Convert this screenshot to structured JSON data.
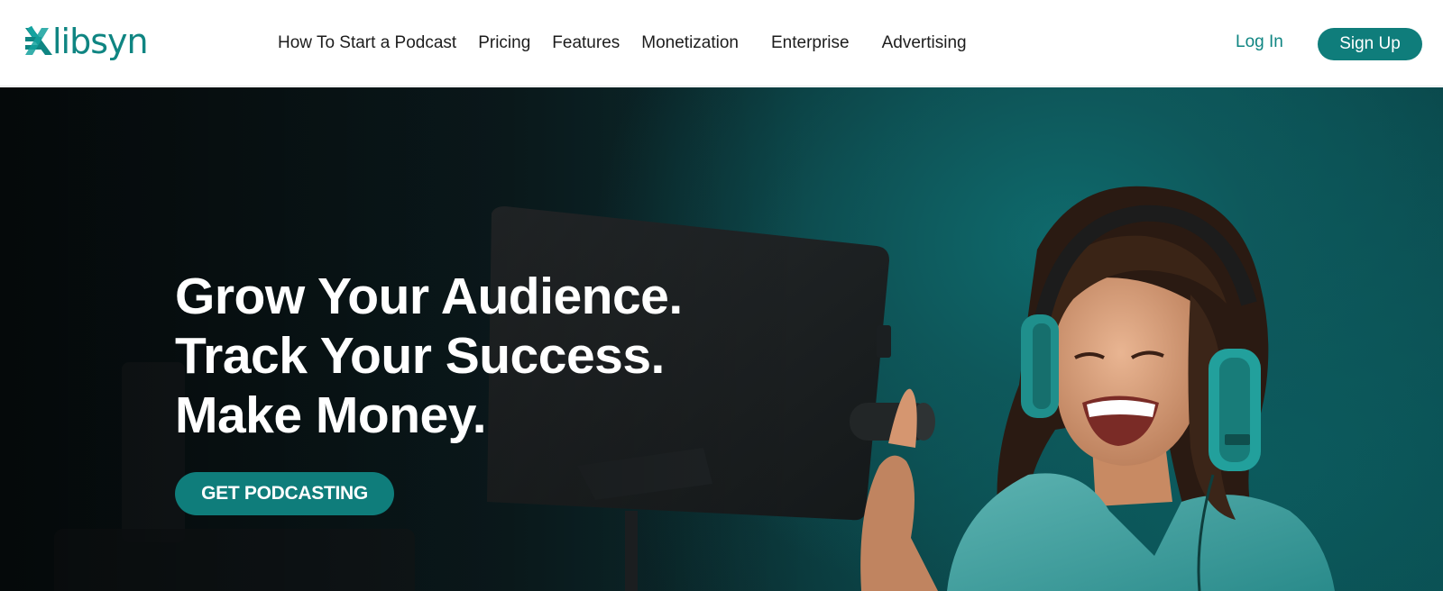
{
  "brand": {
    "logo_text": "libsyn",
    "logo_icon": "libsyn-mark-icon",
    "accent_color": "#0f7d7b"
  },
  "nav": {
    "items": [
      {
        "label": "How To Start a Podcast"
      },
      {
        "label": "Pricing"
      },
      {
        "label": "Features"
      },
      {
        "label": "Monetization"
      },
      {
        "label": "Enterprise"
      },
      {
        "label": "Advertising"
      }
    ],
    "login_label": "Log In",
    "signup_label": "Sign Up"
  },
  "hero": {
    "headline": [
      "Grow Your Audience.",
      "Track Your Success.",
      "Make Money."
    ],
    "cta_label": "GET PODCASTING",
    "image_description_icon": "podcaster-photo"
  }
}
